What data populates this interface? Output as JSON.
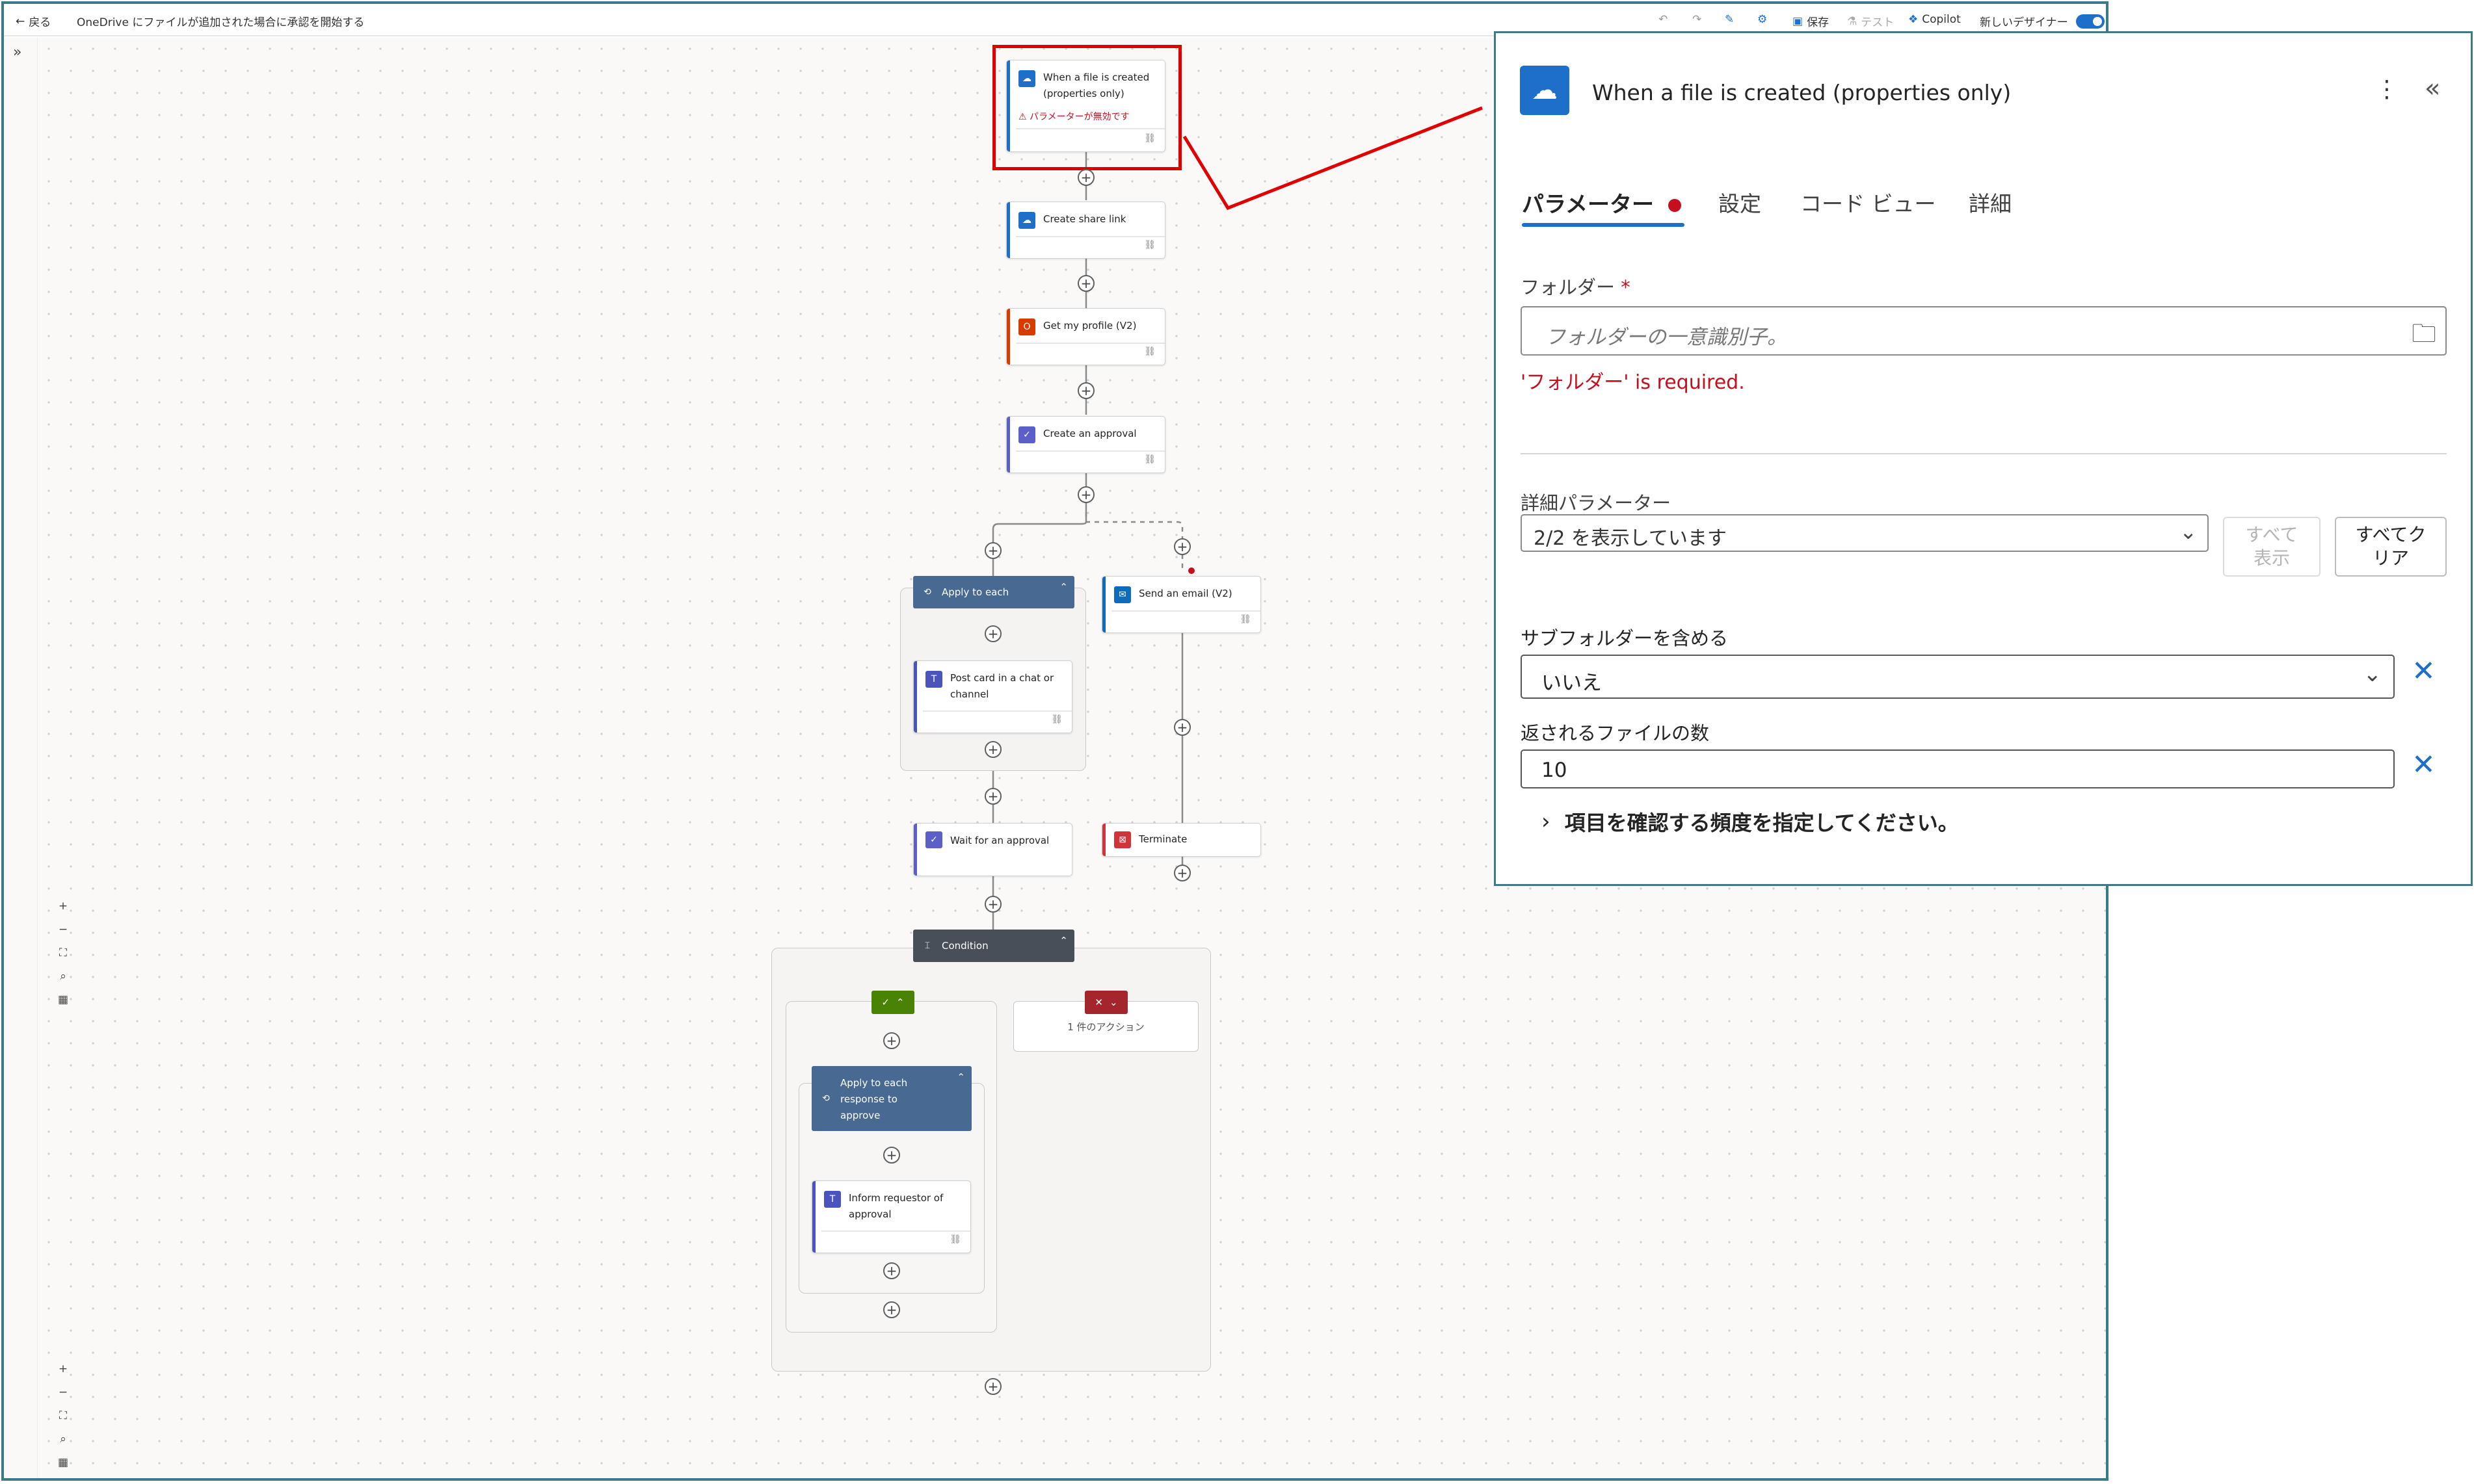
{
  "topbar": {
    "back_label": "戻る",
    "flow_title": "OneDrive にファイルが追加された場合に承認を開始する",
    "save_label": "保存",
    "test_label": "テスト",
    "copilot_label": "Copilot",
    "new_designer_label": "新しいデザイナー"
  },
  "flow": {
    "trigger": {
      "title": "When a file is created (properties only)",
      "error": "パラメーターが無効です"
    },
    "create_share_link": "Create share link",
    "get_my_profile": "Get my profile (V2)",
    "create_approval": "Create an approval",
    "apply_to_each": "Apply to each",
    "post_card": "Post card in a chat or channel",
    "send_email": "Send an email (V2)",
    "wait_approval": "Wait for an approval",
    "terminate": "Terminate",
    "condition": "Condition",
    "false_branch_summary": "1 件のアクション",
    "apply_to_each_response": "Apply to each response to approve",
    "inform_requestor": "Inform requestor of approval"
  },
  "panel": {
    "title": "When a file is created (properties only)",
    "tabs": [
      "パラメーター",
      "設定",
      "コード ビュー",
      "詳細"
    ],
    "folder_label": "フォルダー",
    "required_mark": "*",
    "folder_placeholder": "フォルダーの一意識別子。",
    "folder_error": "'フォルダー' is required.",
    "advanced_label": "詳細パラメーター",
    "advanced_value": "2/2 を表示しています",
    "show_all_label": "すべて表示",
    "clear_all_label": "すべてクリア",
    "subfolders_label": "サブフォルダーを含める",
    "subfolders_value": "いいえ",
    "file_count_label": "返されるファイルの数",
    "file_count_value": "10",
    "frequency_label": "項目を確認する頻度を指定してください。"
  },
  "colors": {
    "accent": "#1e6fc9",
    "error": "#c50f1f",
    "annotation": "#e00000",
    "scope_header": "#486991",
    "condition_header": "#484f58",
    "true_branch": "#498205",
    "false_branch": "#a4262c"
  }
}
